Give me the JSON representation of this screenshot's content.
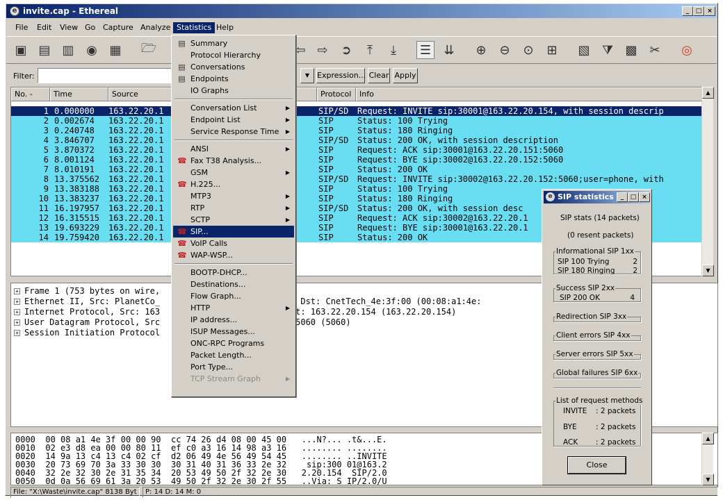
{
  "window": {
    "title": "invite.cap - Ethereal"
  },
  "menubar": [
    "File",
    "Edit",
    "View",
    "Go",
    "Capture",
    "Analyze",
    "Statistics",
    "Help"
  ],
  "filter": {
    "label": "Filter:",
    "value": "",
    "expression": "Expression...",
    "clear": "Clear",
    "apply": "Apply"
  },
  "columns": [
    "No. -",
    "Time",
    "Source",
    "Protocol",
    "Info"
  ],
  "packets": [
    {
      "no": "1",
      "time": "0.000000",
      "src": "163.22.20.1",
      "proto": "SIP/SD",
      "info": "Request: INVITE sip:30001@163.22.20.154, with session descrip"
    },
    {
      "no": "2",
      "time": "0.002674",
      "src": "163.22.20.1",
      "proto": "SIP",
      "info": "Status: 100 Trying"
    },
    {
      "no": "3",
      "time": "0.240748",
      "src": "163.22.20.1",
      "proto": "SIP",
      "info": "Status: 180 Ringing"
    },
    {
      "no": "4",
      "time": "3.846707",
      "src": "163.22.20.1",
      "proto": "SIP/SD",
      "info": "Status: 200 OK, with session description"
    },
    {
      "no": "5",
      "time": "3.870372",
      "src": "163.22.20.1",
      "proto": "SIP",
      "info": "Request: ACK sip:30001@163.22.20.151:5060"
    },
    {
      "no": "6",
      "time": "8.001124",
      "src": "163.22.20.1",
      "proto": "SIP",
      "info": "Request: BYE sip:30002@163.22.20.152:5060"
    },
    {
      "no": "7",
      "time": "8.010191",
      "src": "163.22.20.1",
      "proto": "SIP",
      "info": "Status: 200 OK"
    },
    {
      "no": "8",
      "time": "13.375562",
      "src": "163.22.20.1",
      "proto": "SIP/SD",
      "info": "Request: INVITE sip:30002@163.22.20.152:5060;user=phone, with"
    },
    {
      "no": "9",
      "time": "13.383188",
      "src": "163.22.20.1",
      "proto": "SIP",
      "info": "Status: 100 Trying"
    },
    {
      "no": "10",
      "time": "13.383237",
      "src": "163.22.20.1",
      "proto": "SIP",
      "info": "Status: 180 Ringing"
    },
    {
      "no": "11",
      "time": "16.197957",
      "src": "163.22.20.1",
      "proto": "SIP/SD",
      "info": "Status: 200 OK, with session desc"
    },
    {
      "no": "12",
      "time": "16.315515",
      "src": "163.22.20.1",
      "proto": "SIP",
      "info": "Request: ACK sip:30002@163.22.20.1"
    },
    {
      "no": "13",
      "time": "19.693229",
      "src": "163.22.20.1",
      "proto": "SIP",
      "info": "Request: BYE sip:30001@163.22.20.1"
    },
    {
      "no": "14",
      "time": "19.759420",
      "src": "163.22.20.1",
      "proto": "SIP",
      "info": "Status: 200 OK"
    }
  ],
  "details": [
    "Frame 1 (753 bytes on wire,",
    "Ethernet II, Src: PlanetCo_                    26:d4), Dst: CnetTech_4e:3f:00 (00:08:a1:4e:",
    "Internet Protocol, Src: 163                   152), Dst: 163.22.20.154 (163.22.20.154)",
    "User Datagram Protocol, Src                   t Port: 5060 (5060)",
    "Session Initiation Protocol"
  ],
  "hex": [
    "0000  00 08 a1 4e 3f 00 00 90  cc 74 26 d4 08 00 45 00   ...N?... .t&...E.",
    "0010  02 e3 d8 ea 00 00 80 11  ef c0 a3 16 14 98 a3 16   ........ ........",
    "0020  14 9a 13 c4 13 c4 02 cf  d2 06 49 4e 56 49 54 45   ........ ..INVITE",
    "0030  20 73 69 70 3a 33 30 30  30 31 40 31 36 33 2e 32    sip:300 01@163.2",
    "0040  32 2e 32 30 2e 31 35 34  20 53 49 50 2f 32 2e 30   2.20.154  SIP/2.0",
    "0050  0d 0a 56 69 61 3a 20 53  49 50 2f 32 2e 30 2f 55   ..Via: S IP/2.0/U"
  ],
  "status": {
    "file": "File: \"X:\\Waste\\invite.cap\" 8138 Byt",
    "counts": "P: 14 D: 14 M: 0"
  },
  "stats_menu": {
    "items": [
      {
        "label": "Summary",
        "icon": "summary-icon"
      },
      {
        "label": "Protocol Hierarchy"
      },
      {
        "label": "Conversations",
        "icon": "conversations-icon"
      },
      {
        "label": "Endpoints",
        "icon": "endpoints-icon"
      },
      {
        "label": "IO Graphs"
      },
      {
        "sep": true
      },
      {
        "label": "Conversation List",
        "sub": true
      },
      {
        "label": "Endpoint List",
        "sub": true
      },
      {
        "label": "Service Response Time",
        "sub": true
      },
      {
        "sep": true
      },
      {
        "label": "ANSI",
        "sub": true
      },
      {
        "label": "Fax T38 Analysis...",
        "icon": "fax-icon"
      },
      {
        "label": "GSM",
        "sub": true
      },
      {
        "label": "H.225...",
        "icon": "h225-icon"
      },
      {
        "label": "MTP3",
        "sub": true
      },
      {
        "label": "RTP",
        "sub": true
      },
      {
        "label": "SCTP",
        "sub": true
      },
      {
        "label": "SIP...",
        "icon": "sip-icon",
        "hl": true
      },
      {
        "label": "VoIP Calls",
        "icon": "voip-icon"
      },
      {
        "label": "WAP-WSP...",
        "icon": "wap-icon"
      },
      {
        "sep": true
      },
      {
        "label": "BOOTP-DHCP..."
      },
      {
        "label": "Destinations..."
      },
      {
        "label": "Flow Graph..."
      },
      {
        "label": "HTTP",
        "sub": true
      },
      {
        "label": "IP address..."
      },
      {
        "label": "ISUP Messages..."
      },
      {
        "label": "ONC-RPC Programs"
      },
      {
        "label": "Packet Length..."
      },
      {
        "label": "Port Type..."
      },
      {
        "label": "TCP Stream Graph",
        "sub": true,
        "dis": true
      }
    ]
  },
  "sip_dialog": {
    "title": "SIP statistics",
    "summary": "SIP stats (14 packets)",
    "resent": "(0 resent packets)",
    "info_title": "Informational  SIP 1xx",
    "trying": "SIP 100 Trying",
    "trying_n": "2",
    "ringing": "SIP 180 Ringing",
    "ringing_n": "2",
    "success_title": "Success       SIP 2xx",
    "ok": "SIP 200 OK",
    "ok_n": "4",
    "redirection": "Redirection    SIP 3xx",
    "client": "Client errors  SIP 4xx",
    "server": "Server errors  SIP 5xx",
    "global": "Global failures  SIP 6xx",
    "methods_title": "List of request methods",
    "invite": "INVITE",
    "invite_v": ":  2 packets",
    "bye": "BYE",
    "bye_v": ":  2 packets",
    "ack": "ACK",
    "ack_v": ":  2 packets",
    "close": "Close"
  }
}
